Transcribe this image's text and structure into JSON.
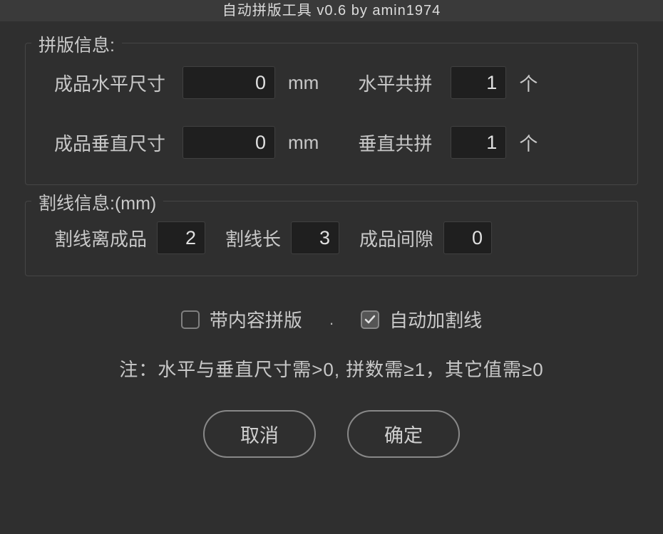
{
  "title": "自动拼版工具 v0.6   by amin1974",
  "group1": {
    "title": "拼版信息:",
    "row1": {
      "label1": "成品水平尺寸",
      "value1": "0",
      "unit1": "mm",
      "label2": "水平共拼",
      "value2": "1",
      "unit2": "个"
    },
    "row2": {
      "label1": "成品垂直尺寸",
      "value1": "0",
      "unit1": "mm",
      "label2": "垂直共拼",
      "value2": "1",
      "unit2": "个"
    }
  },
  "group2": {
    "title": "割线信息:(mm)",
    "row": {
      "label1": "割线离成品",
      "value1": "2",
      "label2": "割线长",
      "value2": "3",
      "label3": "成品间隙",
      "value3": "0"
    }
  },
  "checks": {
    "c1": {
      "label": "带内容拼版",
      "checked": false
    },
    "sep": ".",
    "c2": {
      "label": "自动加割线",
      "checked": true
    }
  },
  "note": "注：水平与垂直尺寸需>0, 拼数需≥1，其它值需≥0",
  "buttons": {
    "cancel": "取消",
    "ok": "确定"
  }
}
